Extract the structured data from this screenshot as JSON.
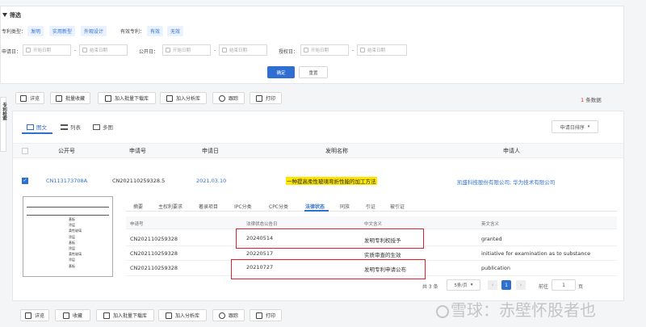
{
  "filter": {
    "title": "筛选",
    "patent_type_label": "专利类型：",
    "patent_types": [
      "发明",
      "实用新型",
      "外观设计"
    ],
    "valid_label": "有效专利：",
    "valid_options": [
      "有效",
      "无效"
    ],
    "apply_date_label": "申请日：",
    "pub_date_label": "公开日：",
    "grant_date_label": "授权日：",
    "start_placeholder": "开始日期",
    "end_placeholder": "结束日期",
    "dash": "-",
    "confirm": "确定",
    "reset": "重置"
  },
  "toolbar": {
    "buttons": [
      "详览",
      "批量收藏",
      "加入批量下载库",
      "加入分析库",
      "跟踪",
      "打印"
    ],
    "count_num": "1",
    "count_text": "条数据"
  },
  "side_label": "专利检索",
  "views": {
    "tabs": [
      "图文",
      "列表",
      "多图"
    ],
    "sort": "申请日排序"
  },
  "table": {
    "headers": [
      "公开号",
      "申请号",
      "申请日",
      "发明名称",
      "申请人"
    ],
    "row": {
      "pub_no": "CN113173708A",
      "app_no": "CN202110259328.5",
      "app_date": "2021.03.10",
      "title": "一种提高柔性玻璃弯折性能的加工方法",
      "applicant": "凯盛科技股份有限公司; 华为技术有限公司"
    }
  },
  "detail_tabs": [
    "摘要",
    "主权利要求",
    "著录项目",
    "IPC分类",
    "CPC分类",
    "法律状态",
    "同族",
    "引证",
    "被引证"
  ],
  "legal": {
    "headers": [
      "申请号",
      "法律状态公告日",
      "中文含义",
      "英文含义"
    ],
    "rows": [
      {
        "app": "CN202110259328",
        "date": "20240514",
        "cn": "发明专利权授予",
        "en": "granted"
      },
      {
        "app": "CN202110259328",
        "date": "20220517",
        "cn": "实质审查的生效",
        "en": "initiative for examination as to substance"
      },
      {
        "app": "CN202110259328",
        "date": "20210727",
        "cn": "发明专利申请公布",
        "en": "publication"
      }
    ]
  },
  "pagination": {
    "total": "共 3 条",
    "per_page": "5条/页",
    "current": "1",
    "goto_label": "前往",
    "goto_value": "1",
    "page_suffix": "页"
  },
  "thumb_labels": [
    "基板",
    "涂层",
    "柔性玻璃",
    "涂层",
    "基板",
    "涂层",
    "柔性玻璃",
    "涂层",
    "基板"
  ],
  "bottom_toolbar": {
    "buttons": [
      "详览",
      "收藏",
      "加入批量下载库",
      "加入分析库",
      "跟踪",
      "打印"
    ]
  },
  "watermark": "雪球：赤壁怀股者也",
  "colors": {
    "accent": "#2f6fd1",
    "highlight": "#ffe600",
    "red": "#d9232e"
  }
}
